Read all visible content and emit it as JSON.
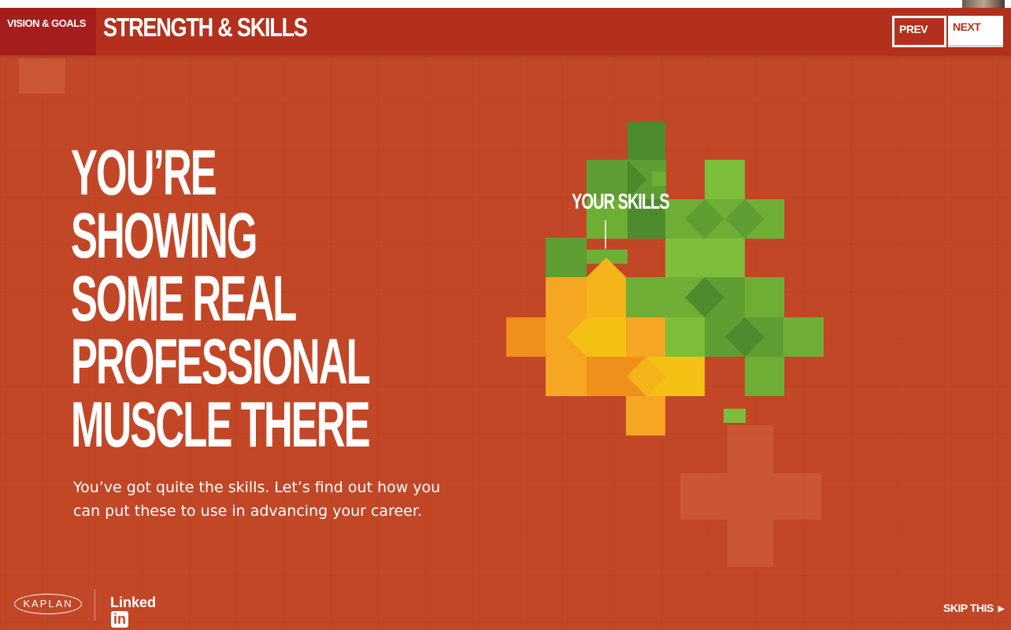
{
  "header": {
    "section_tab": "VISION & GOALS",
    "page_title": "STRENGTH & SKILLS",
    "prev_label": "PREV",
    "next_label": "NEXT"
  },
  "main": {
    "headline_lines": [
      "YOU’RE",
      "SHOWING",
      "SOME REAL",
      "PROFESSIONAL",
      "MUSCLE THERE"
    ],
    "subtext_line1": "You’ve got quite the skills. Let’s find out how you",
    "subtext_line2": "can put these to use in advancing your career.",
    "puzzle_label": "YOUR SKILLS"
  },
  "footer": {
    "kaplan_logo": "KAPLAN",
    "linkedin_logo_text": "Linked",
    "linkedin_logo_in": "in",
    "skip_label": "SKIP THIS",
    "skip_icon": "caret-right-icon"
  },
  "colors": {
    "background": "#c24727",
    "header": "#b3301d",
    "section_tab": "#a41e1e",
    "green_dark": "#4e8a2e",
    "green": "#6fae35",
    "green_light": "#7cbd3a",
    "orange": "#f39c12",
    "yellow": "#f5c014"
  }
}
